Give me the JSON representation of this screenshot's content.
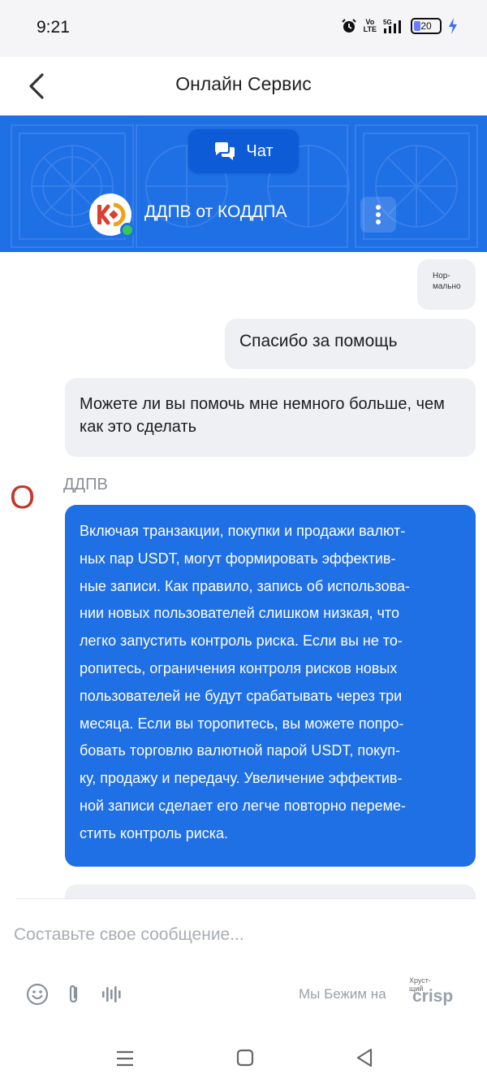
{
  "status_bar": {
    "time": "9:21",
    "volte_top": "Vo",
    "volte_bottom": "LTE",
    "network": "5G",
    "battery": "20"
  },
  "header": {
    "title": "Онлайн Сервис"
  },
  "banner": {
    "chat_tab_label": "Чат",
    "agent_name": "ДДПВ от КОДДПА",
    "accent_color": "#1f6fe5"
  },
  "messages": {
    "tiny_bubble": "Нор-\nмально",
    "thanks": "Спасибо за помощь",
    "question": "Можете ли вы помочь мне немного больше, чем как это сделать",
    "operator_initial": "O",
    "operator_name": "ДДПВ",
    "reply_lines": [
      "Включая транзакции, покупки и продажи валют-",
      "ных пар USDT, могут формировать эффектив-",
      "ные записи. Как правило, запись об использова-",
      "нии новых пользователей слишком низкая, что",
      "легко запустить контроль риска. Если вы не то-",
      "ропитесь, ограничения контроля рисков новых",
      "пользователей не будут срабатывать через три",
      "месяца. Если вы торопитесь, вы можете попро-",
      "бовать торговлю валютной парой USDT, покуп-",
      "ку, продажу и передачу. Увеличение эффектив-",
      "ной записи сделает его легче повторно переме-",
      "стить контроль риска."
    ]
  },
  "composer": {
    "placeholder": "Составьте свое сообщение...",
    "powered_by": "Мы Бежим на",
    "brand": "crisp",
    "brand_note": "Хруст-\nщий"
  }
}
